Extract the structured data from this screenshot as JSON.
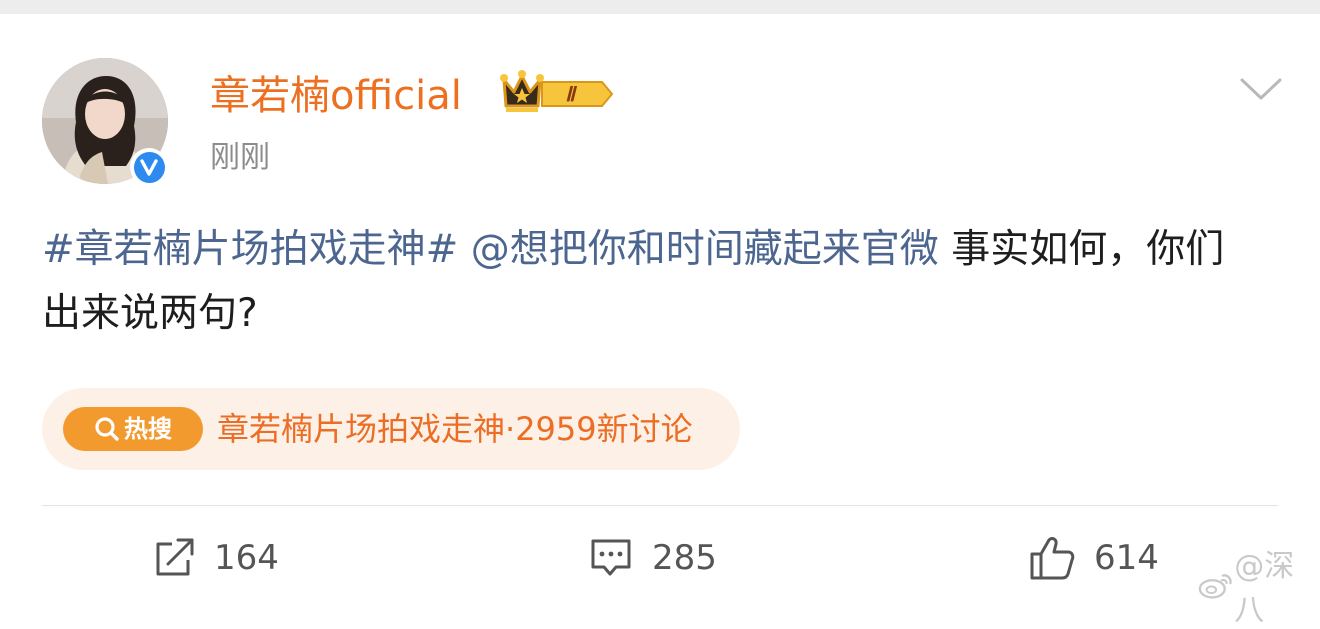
{
  "post": {
    "username": "章若楠official",
    "vip_level": "Ⅱ",
    "timestamp": "刚刚",
    "text": {
      "hashtag": "#章若楠片场拍戏走神#",
      "mention": "@想把你和时间藏起来官微",
      "content": "事实如何，你们出来说两句?"
    }
  },
  "hot_search": {
    "badge_label": "热搜",
    "topic": "章若楠片场拍戏走神",
    "stats": "·2959新讨论"
  },
  "actions": {
    "repost_count": "164",
    "comment_count": "285",
    "like_count": "614"
  },
  "watermark": {
    "text": "@深八"
  },
  "colors": {
    "username": "#ed7021",
    "link": "#4c6690",
    "hot_badge": "#f39a2f",
    "hot_text": "#ec6d24",
    "hot_pill_bg": "#fdf1e7",
    "verified": "#2d8bf0"
  },
  "icons": [
    "verified-icon",
    "vip-crown-icon",
    "chevron-down-icon",
    "search-icon",
    "repost-icon",
    "comment-icon",
    "like-icon",
    "weibo-logo-icon"
  ]
}
